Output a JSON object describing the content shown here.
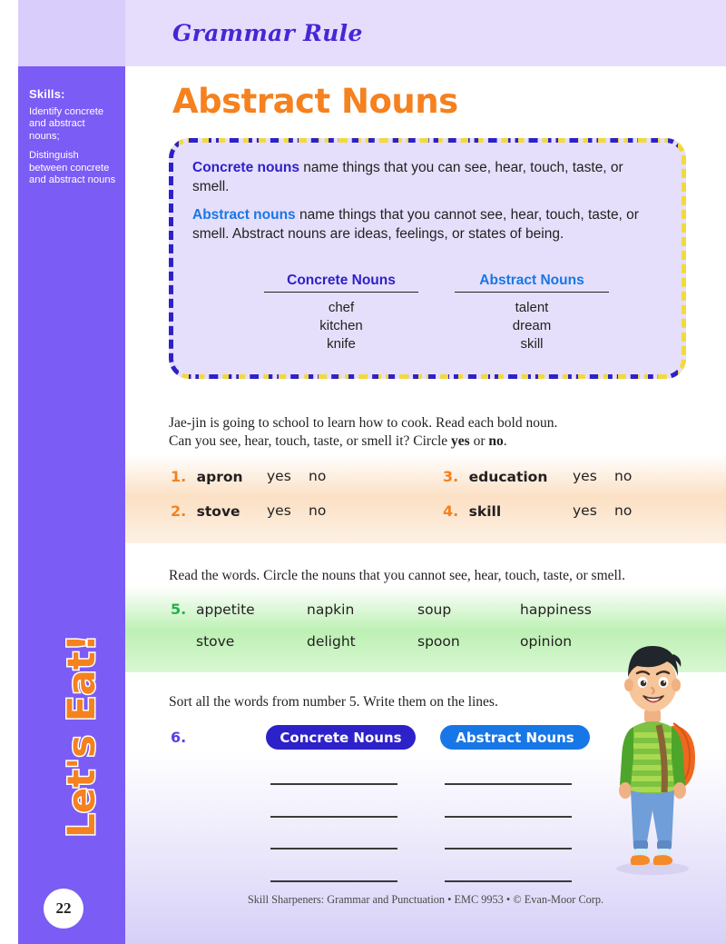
{
  "sidebar": {
    "skills_title": "Skills:",
    "skills": [
      "Identify concrete and abstract nouns;",
      "Distinguish between concrete and abstract nouns"
    ],
    "vertical_label": "Let's Eat!",
    "page_number": "22"
  },
  "header": {
    "ribbon_title": "Grammar Rule",
    "page_title": "Abstract Nouns"
  },
  "rule_box": {
    "paragraph1_bold": "Concrete nouns",
    "paragraph1_rest": " name things that you can see, hear, touch, taste, or smell.",
    "paragraph2_bold": "Abstract nouns",
    "paragraph2_rest": " name things that you cannot see, hear, touch, taste, or smell. Abstract nouns are ideas, feelings, or states of being.",
    "table": {
      "headers": [
        "Concrete Nouns",
        "Abstract Nouns"
      ],
      "concrete": [
        "chef",
        "kitchen",
        "knife"
      ],
      "abstract": [
        "talent",
        "dream",
        "skill"
      ]
    }
  },
  "exercise1": {
    "instruction_line1": "Jae-jin is going to school to learn how to cook. Read each bold noun.",
    "instruction_line2_pre": "Can you see, hear, touch, taste, or smell it? Circle ",
    "instruction_yes": "yes",
    "instruction_mid": " or ",
    "instruction_no": "no",
    "instruction_end": ".",
    "items": [
      {
        "num": "1.",
        "word": "apron",
        "yes": "yes",
        "no": "no"
      },
      {
        "num": "2.",
        "word": "stove",
        "yes": "yes",
        "no": "no"
      },
      {
        "num": "3.",
        "word": "education",
        "yes": "yes",
        "no": "no"
      },
      {
        "num": "4.",
        "word": "skill",
        "yes": "yes",
        "no": "no"
      }
    ]
  },
  "exercise2": {
    "instruction": "Read the words. Circle the nouns that you cannot see, hear, touch, taste, or smell.",
    "num": "5.",
    "row1": [
      "appetite",
      "napkin",
      "soup",
      "happiness"
    ],
    "row2": [
      "stove",
      "delight",
      "spoon",
      "opinion"
    ]
  },
  "exercise3": {
    "instruction": "Sort all the words from number 5. Write them on the lines.",
    "num": "6.",
    "column_labels": [
      "Concrete Nouns",
      "Abstract Nouns"
    ],
    "lines_per_column": 4
  },
  "footer": {
    "text": "Skill Sharpeners: Grammar and Punctuation • EMC 9953 • © Evan-Moor Corp."
  },
  "colors": {
    "sidebar_purple": "#7b5cf5",
    "ribbon_lavender": "#e6ddfd",
    "title_orange": "#f5811f",
    "concrete_blue": "#2d21c9",
    "abstract_blue": "#1877e6",
    "dash_yellow": "#f2d93c",
    "green_number": "#24b24c"
  }
}
